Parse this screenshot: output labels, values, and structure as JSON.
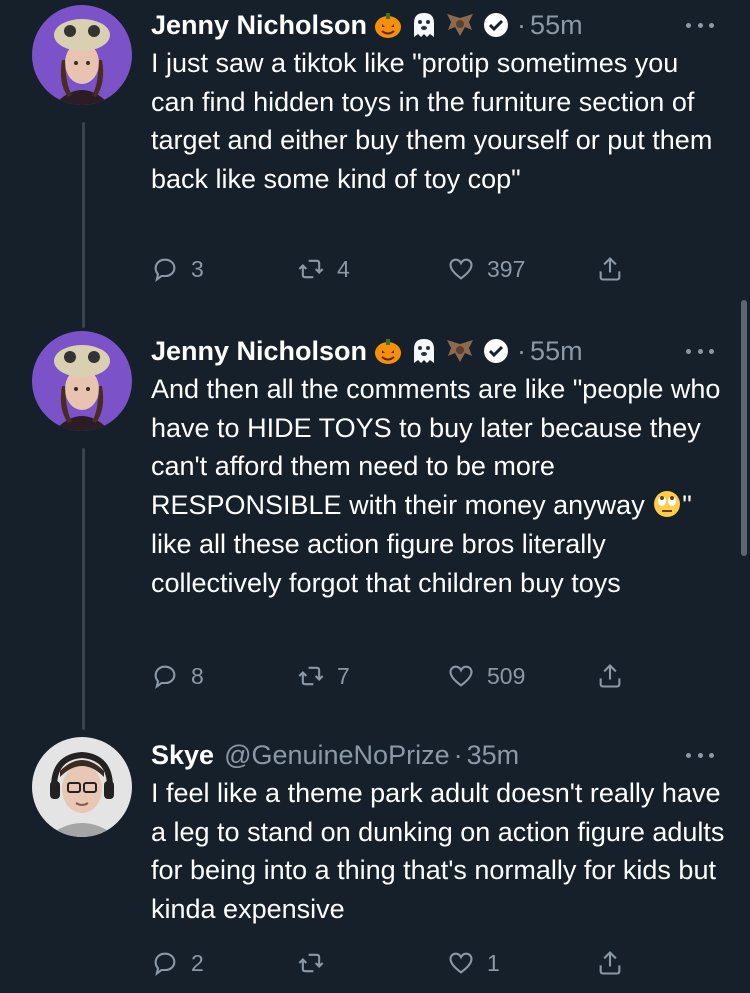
{
  "tweets": [
    {
      "name": "Jenny Nicholson",
      "handle": "",
      "time": "55m",
      "text": "I just saw a tiktok like \"protip sometimes you can find hidden toys in the furniture section of target and either buy them yourself or put them back like some kind of toy cop\"",
      "replies": "3",
      "retweets": "4",
      "likes": "397"
    },
    {
      "name": "Jenny Nicholson",
      "handle": "",
      "time": "55m",
      "text_before_emoji": "And then all the comments are like \"people who have to HIDE TOYS to buy later because they can't afford them need to be more RESPONSIBLE with their money anyway ",
      "text_after_emoji": "\" like all these action figure bros literally collectively forgot that children buy toys",
      "replies": "8",
      "retweets": "7",
      "likes": "509"
    },
    {
      "name": "Skye",
      "handle": "@GenuineNoPrize",
      "time": "35m",
      "text": "I feel like a theme park adult doesn't really have a leg to stand on dunking on action figure adults for being into a thing that's normally for kids but kinda expensive",
      "replies": "2",
      "retweets": "",
      "likes": "1"
    }
  ],
  "separator": "·",
  "colors": {
    "background": "#15202b",
    "muted": "#8b98a5",
    "text": "#ffffff",
    "thread_line": "#38444d"
  }
}
